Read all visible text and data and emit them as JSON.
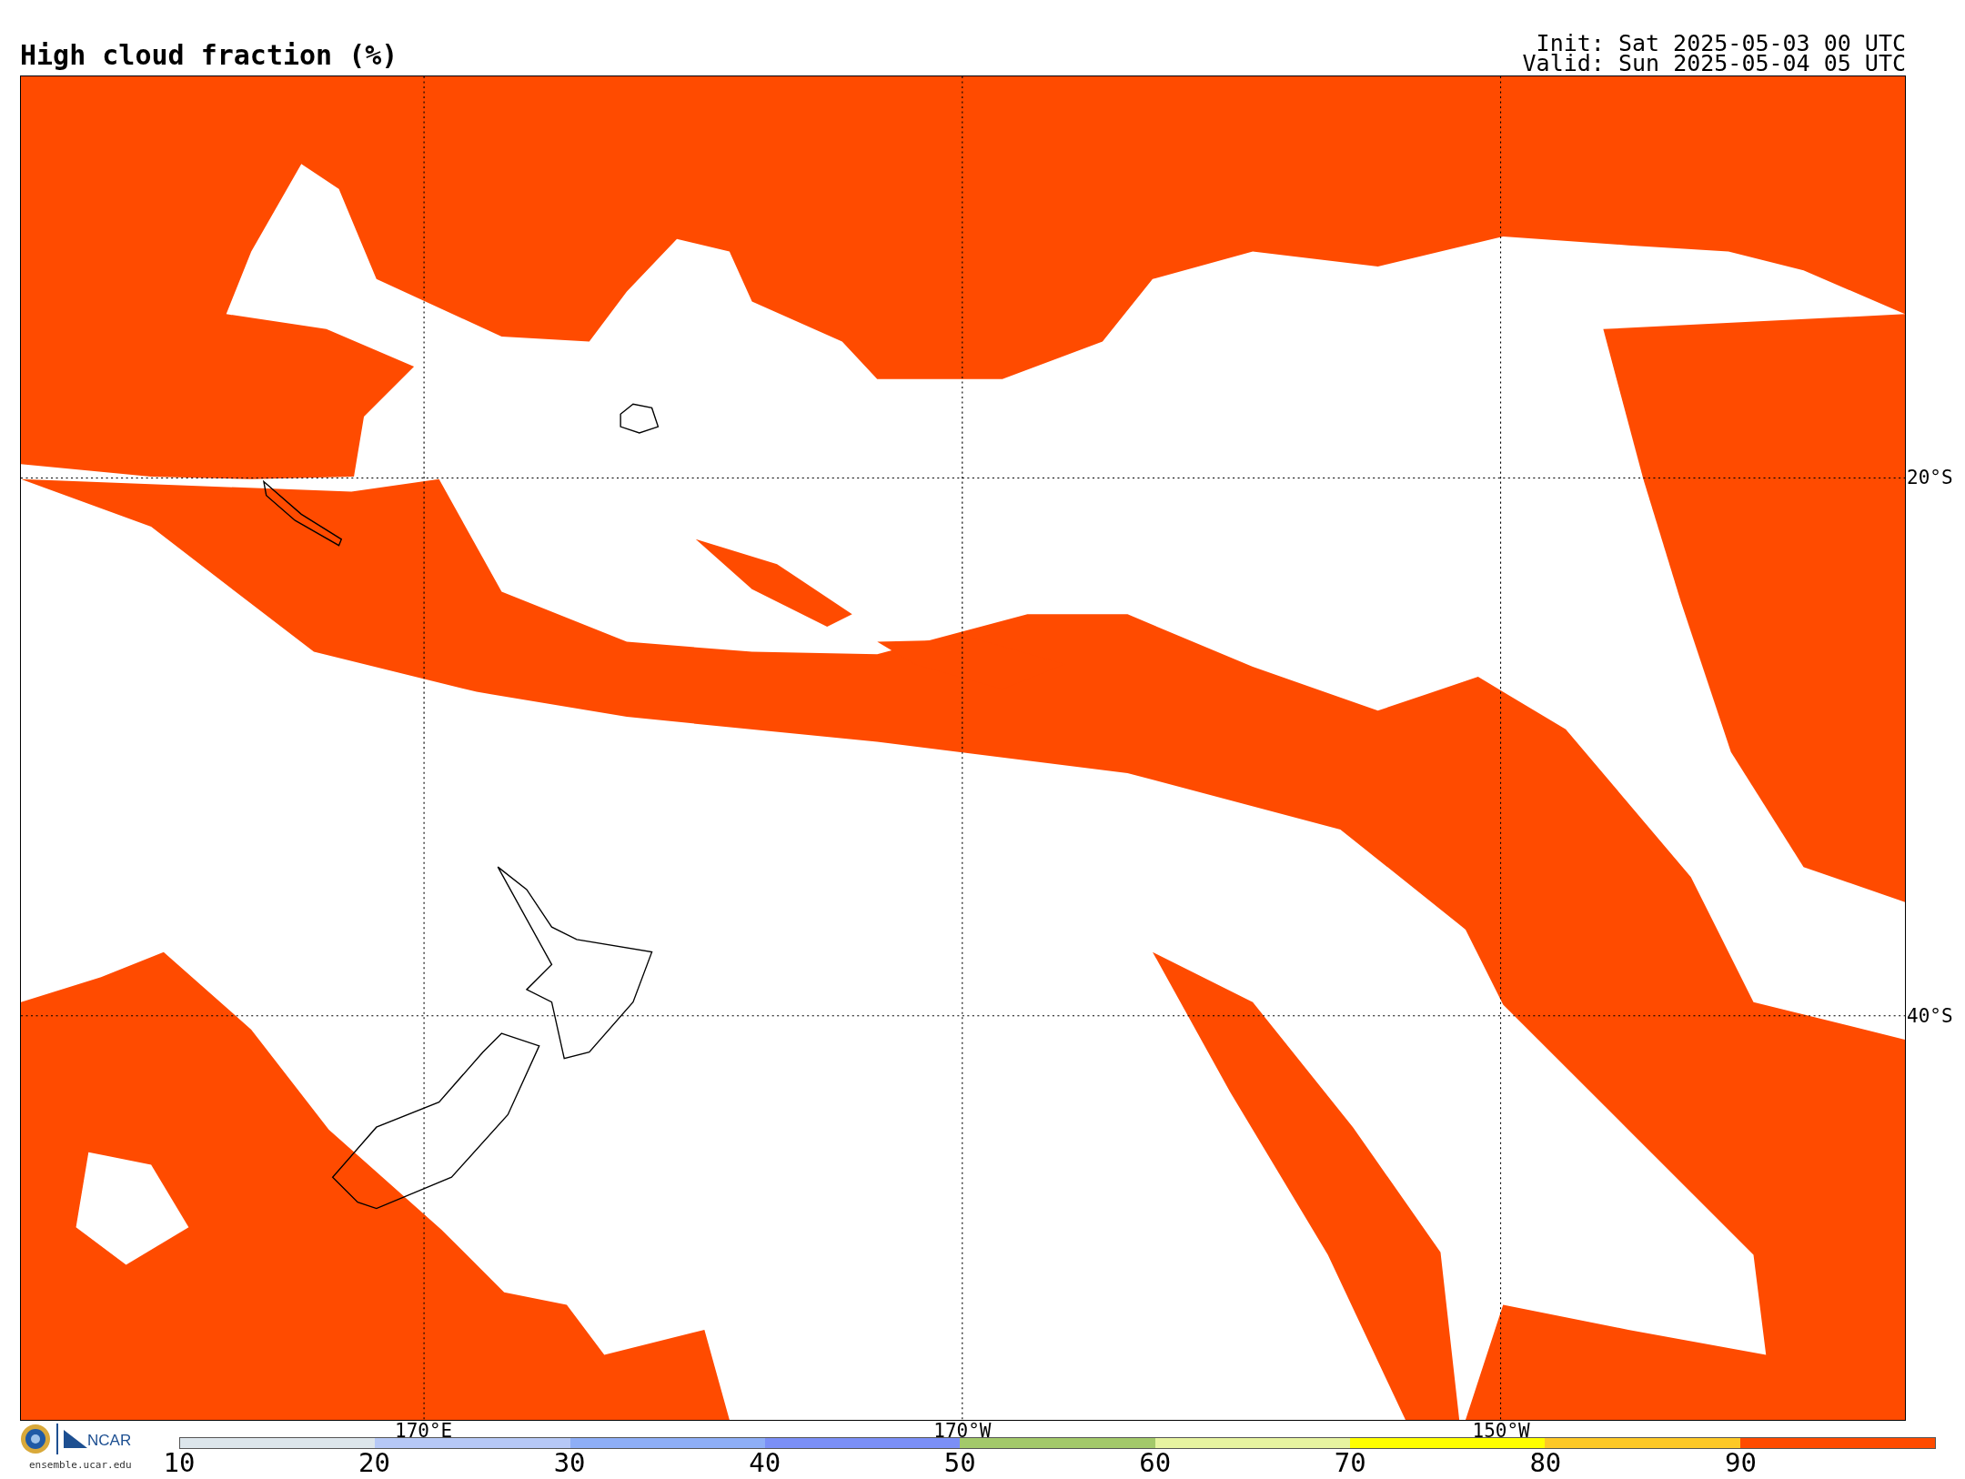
{
  "title": "High cloud fraction (%)",
  "init": "Init: Sat 2025-05-03 00 UTC",
  "valid": "Valid: Sun 2025-05-04 05 UTC",
  "map": {
    "lon_labels": [
      "170°E",
      "170°W",
      "150°W"
    ],
    "lat_labels": [
      "20°S",
      "40°S"
    ]
  },
  "colorbar": {
    "segments": [
      {
        "color": "#dce5eb"
      },
      {
        "color": "#b6c8f6"
      },
      {
        "color": "#8eaef6"
      },
      {
        "color": "#7b8ff6"
      },
      {
        "color": "#a3c96a"
      },
      {
        "color": "#e6f3a0"
      },
      {
        "color": "#ffff00"
      },
      {
        "color": "#fdc826"
      },
      {
        "color": "#ff4b00"
      }
    ],
    "ticks": [
      "10",
      "20",
      "30",
      "40",
      "50",
      "60",
      "70",
      "80",
      "90"
    ]
  },
  "footer": {
    "logo_text": "NCAR",
    "url": "ensemble.ucar.edu"
  }
}
